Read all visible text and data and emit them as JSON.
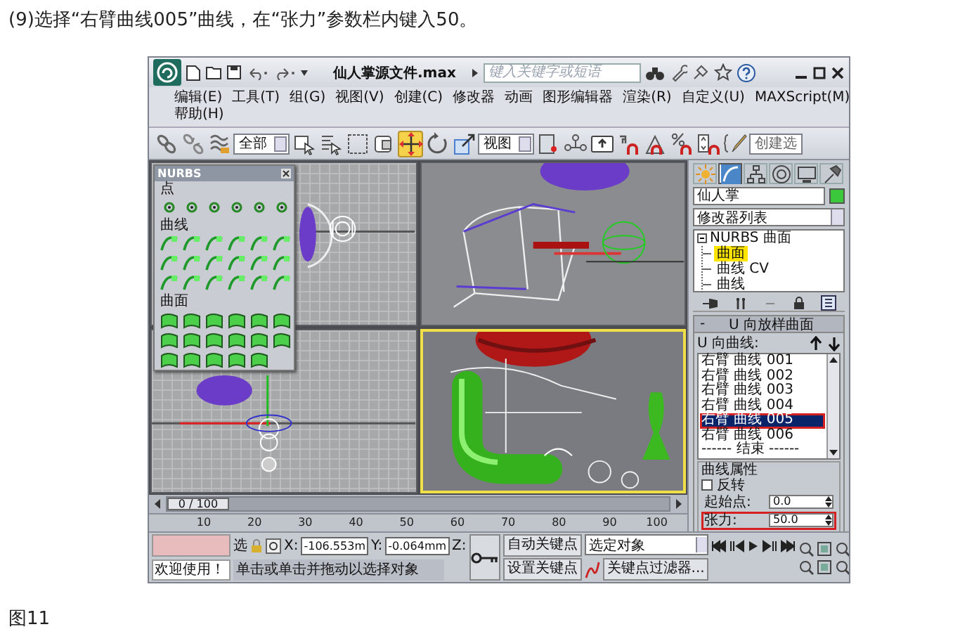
{
  "instruction": "(9)选择“右臂曲线005”曲线，在“张力”参数栏内键入50。",
  "window": {
    "title": "仙人掌源文件.max",
    "search": {
      "placeholder": "键入关键字或短语"
    }
  },
  "menu": [
    [
      "编辑(E)",
      "工具(T)",
      "组(G)",
      "视图(V)",
      "创建(C)",
      "修改器",
      "动画",
      "图形编辑器",
      "渲染(R)",
      "自定义(U)",
      "MAXScript(M)"
    ],
    [
      "帮助(H)"
    ]
  ],
  "toolbar": [
    {
      "kind": "link",
      "selected": false
    },
    {
      "kind": "unlink",
      "selected": false
    },
    {
      "kind": "bind",
      "selected": false
    },
    {
      "kind": "dropdown",
      "value": "全部"
    },
    {
      "kind": "select",
      "selected": false
    },
    {
      "kind": "select_by_name",
      "selected": false
    },
    {
      "kind": "region",
      "selected": false
    },
    {
      "kind": "crossing",
      "selected": false
    },
    {
      "kind": "move",
      "selected": true
    },
    {
      "kind": "rotate",
      "selected": false
    },
    {
      "kind": "scale",
      "selected": false
    },
    {
      "kind": "dropdown",
      "value": "视图"
    },
    {
      "kind": "pivot",
      "selected": false
    },
    {
      "kind": "manipulate",
      "selected": false
    },
    {
      "kind": "shortcut",
      "selected": false
    },
    {
      "kind": "snap",
      "selected": false
    },
    {
      "kind": "angle_snap",
      "selected": false
    },
    {
      "kind": "percent_snap",
      "selected": false
    },
    {
      "kind": "spinner_snap",
      "selected": false
    },
    {
      "kind": "named_selection",
      "selected": false
    },
    {
      "kind": "field",
      "value": "创建选"
    }
  ],
  "nurbs_panel": {
    "title": "NURBS",
    "sections": [
      {
        "label": "点",
        "tools": [
          {
            "kind": "point"
          },
          {
            "kind": "point"
          },
          {
            "kind": "point"
          },
          {
            "kind": "point"
          },
          {
            "kind": "point"
          },
          {
            "kind": "point"
          }
        ]
      },
      {
        "label": "曲线",
        "tools": [
          {
            "kind": "curve"
          },
          {
            "kind": "curve"
          },
          {
            "kind": "curve"
          },
          {
            "kind": "curve"
          },
          {
            "kind": "curve"
          },
          {
            "kind": "curve"
          },
          {
            "kind": "curve"
          },
          {
            "kind": "curve"
          },
          {
            "kind": "curve"
          },
          {
            "kind": "curve"
          },
          {
            "kind": "curve"
          },
          {
            "kind": "curve"
          },
          {
            "kind": "curve"
          },
          {
            "kind": "curve"
          },
          {
            "kind": "curve"
          },
          {
            "kind": "curve"
          },
          {
            "kind": "curve"
          },
          {
            "kind": "curve"
          }
        ]
      },
      {
        "label": "曲面",
        "tools": [
          {
            "kind": "surface"
          },
          {
            "kind": "surface"
          },
          {
            "kind": "surface"
          },
          {
            "kind": "surface"
          },
          {
            "kind": "surface"
          },
          {
            "kind": "surface"
          },
          {
            "kind": "surface"
          },
          {
            "kind": "surface"
          },
          {
            "kind": "surface"
          },
          {
            "kind": "surface"
          },
          {
            "kind": "surface"
          },
          {
            "kind": "surface"
          },
          {
            "kind": "surface"
          },
          {
            "kind": "surface"
          },
          {
            "kind": "surface"
          },
          {
            "kind": "surface"
          },
          {
            "kind": "surface"
          }
        ]
      }
    ]
  },
  "viewports": [
    {
      "kind": "top",
      "selected": false
    },
    {
      "kind": "front",
      "selected": false
    },
    {
      "kind": "left",
      "selected": false
    },
    {
      "kind": "perspective",
      "selected": true
    }
  ],
  "command_panel": {
    "tabs": [
      {
        "kind": "create",
        "selected": false
      },
      {
        "kind": "modify",
        "selected": true
      },
      {
        "kind": "hierarchy",
        "selected": false
      },
      {
        "kind": "motion",
        "selected": false
      },
      {
        "kind": "display",
        "selected": false
      },
      {
        "kind": "utilities",
        "selected": false
      }
    ],
    "object_name": "仙人掌",
    "modifier_list": "修改器列表",
    "stack": [
      {
        "label": "NURBS 曲面",
        "expanded": true,
        "selected": false,
        "children": [
          {
            "label": "曲面",
            "selected": true
          },
          {
            "label": "曲线 CV",
            "selected": false
          },
          {
            "label": "曲线",
            "selected": false
          }
        ]
      }
    ],
    "rollout": {
      "toggle": "-",
      "title": "U 向放样曲面",
      "u_curves_label": "U 向曲线:",
      "curves": [
        {
          "label": "右臂 曲线 001",
          "selected": false,
          "highlighted": false
        },
        {
          "label": "右臂 曲线 002",
          "selected": false,
          "highlighted": false
        },
        {
          "label": "右臂 曲线 003",
          "selected": false,
          "highlighted": false
        },
        {
          "label": "右臂 曲线 004",
          "selected": false,
          "highlighted": false
        },
        {
          "label": "右臂 曲线 005",
          "selected": true,
          "highlighted": true
        },
        {
          "label": "右臂 曲线 006",
          "selected": false,
          "highlighted": false
        },
        {
          "label": "------ 结束 ------",
          "selected": false,
          "highlighted": false
        }
      ],
      "properties": {
        "title": "曲线属性",
        "reverse": {
          "label": "反转",
          "checked": false
        },
        "start_point": {
          "label": "起始点:",
          "value": "0.0",
          "highlighted": false
        },
        "tension": {
          "label": "张力:",
          "value": "50.0",
          "highlighted": true
        }
      }
    }
  },
  "timeline": {
    "frame": "0 / 100",
    "level": 0,
    "ticks": [
      "10",
      "20",
      "30",
      "40",
      "50",
      "60",
      "70",
      "80",
      "90",
      "100"
    ]
  },
  "status_bar": {
    "welcome": "欢迎使用！",
    "lock_label": "选",
    "x_label": "X:",
    "x": "-106.553m",
    "y_label": "Y:",
    "y": "-0.064mm",
    "z_label": "Z:",
    "prompt": "单击或单击并拖动以选择对象",
    "auto_key": "自动关键点",
    "set_key": "设置关键点",
    "key_mode": "选定对象",
    "key_filters": "关键点过滤器..."
  },
  "caption": "图11"
}
